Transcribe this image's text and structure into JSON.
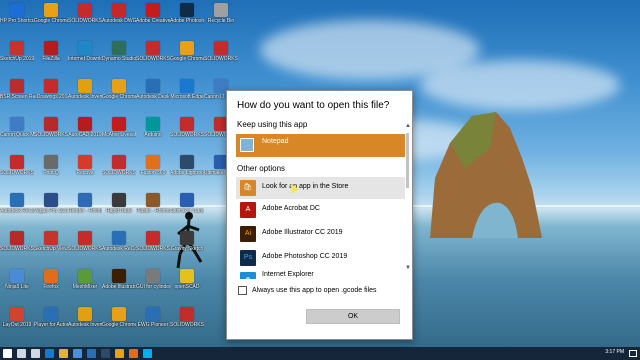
{
  "dialog": {
    "title": "How do you want to open this file?",
    "keep_using_label": "Keep using this app",
    "current_app": {
      "name": "Notepad",
      "icon": "notepad-icon",
      "color": "#7fb3d8"
    },
    "other_options_label": "Other options",
    "other_apps": [
      {
        "name": "Look for an app in the Store",
        "icon": "store-icon",
        "glyph": "🛍",
        "color": "#d88726"
      },
      {
        "name": "Adobe Acrobat DC",
        "icon": "acrobat-icon",
        "glyph": "A",
        "color": "#b3170f"
      },
      {
        "name": "Adobe Illustrator CC 2019",
        "icon": "illustrator-icon",
        "glyph": "Ai",
        "color": "#3b1f05"
      },
      {
        "name": "Adobe Photoshop CC 2019",
        "icon": "photoshop-icon",
        "glyph": "Ps",
        "color": "#0f2b48"
      },
      {
        "name": "Internet Explorer",
        "icon": "internet-explorer-icon",
        "glyph": "e",
        "color": "#1a8ed8"
      }
    ],
    "always_use_label": "Always use this app to open .gcode files",
    "always_use_checked": false,
    "ok_label": "OK"
  },
  "desktop_icons": [
    {
      "label": "HP Pro Shortcut",
      "color": "#1c6ed6"
    },
    {
      "label": "SketchUp 2019",
      "color": "#c4342c"
    },
    {
      "label": "BSR Screen Recorder 6",
      "color": "#b82e2e"
    },
    {
      "label": "Canon Quick Menu",
      "color": "#3e7cc4"
    },
    {
      "label": "SOLIDWORKS 2018",
      "color": "#c42c2c"
    },
    {
      "label": "Autodesk ReCap",
      "color": "#2a6fb6"
    },
    {
      "label": "SOLIDWORKS File Utilities",
      "color": "#b62a2a"
    },
    {
      "label": "Ninja5 Lite",
      "color": "#4b8ad6"
    },
    {
      "label": "LayOut 2019",
      "color": "#d2432d"
    },
    {
      "label": "Google Chrome",
      "color": "#e8a117"
    },
    {
      "label": "FileZilla",
      "color": "#b51d1d"
    },
    {
      "label": "eDrawings 2018",
      "color": "#c42c2c"
    },
    {
      "label": "SOLIDWORKS 2018",
      "color": "#b62a2a"
    },
    {
      "label": "Print Q",
      "color": "#6a6a6a"
    },
    {
      "label": "Vegas Pro 16.0",
      "color": "#2b4d8a"
    },
    {
      "label": "SketchUp Viewer 2019",
      "color": "#c4342c"
    },
    {
      "label": "Firefox",
      "color": "#e06d1b"
    },
    {
      "label": "Player for Autodesk",
      "color": "#2a6fb6"
    },
    {
      "label": "SOLIDWORKS 2018 x64",
      "color": "#c42c2c"
    },
    {
      "label": "Internet Download Manager",
      "color": "#1e88c8"
    },
    {
      "label": "Autodesk Inventor Pro",
      "color": "#e0a012"
    },
    {
      "label": "AutoCAD 2019",
      "color": "#b71c1c"
    },
    {
      "label": "Recuva",
      "color": "#d83a2a"
    },
    {
      "label": "Render - Rhinoceros",
      "color": "#2e6bb4"
    },
    {
      "label": "SOLIDWORKS Electrical",
      "color": "#c42c2c"
    },
    {
      "label": "MeshMixer",
      "color": "#5a9a3a"
    },
    {
      "label": "Autodesk Inventor",
      "color": "#e0a012"
    },
    {
      "label": "Autodesk DWG TrueView",
      "color": "#c62828"
    },
    {
      "label": "Dynamo Studio",
      "color": "#2f6f5a"
    },
    {
      "label": "Google Chrome",
      "color": "#e8a117"
    },
    {
      "label": "McAfee Livesafe",
      "color": "#c41c1c"
    },
    {
      "label": "SOLIDWORKS Composer",
      "color": "#c42c2c"
    },
    {
      "label": "RapidTrade",
      "color": "#3a3a3a"
    },
    {
      "label": "Autodesk ReCap Pro",
      "color": "#2a6fb6"
    },
    {
      "label": "Adobe Illustrator",
      "color": "#3b1f05"
    },
    {
      "label": "Google Chrome",
      "color": "#e8a117"
    },
    {
      "label": "Adobe Creative Cloud",
      "color": "#c41c1c"
    },
    {
      "label": "SOLIDWORKS Composer Player",
      "color": "#c42c2c"
    },
    {
      "label": "Autodesk Desktop App",
      "color": "#2a6fb6"
    },
    {
      "label": "Arduino",
      "color": "#00979c"
    },
    {
      "label": "Fusion 360",
      "color": "#e0701b"
    },
    {
      "label": "Plastic - Rhinoceros",
      "color": "#8a5a2a"
    },
    {
      "label": "SOLIDWORKS Plastics",
      "color": "#c42c2c"
    },
    {
      "label": "GUI for cylinders",
      "color": "#7a7a7a"
    },
    {
      "label": "EWG Pioneer",
      "color": "#2a6fb6"
    },
    {
      "label": "Adobe Photoshop CC",
      "color": "#0f2b48"
    },
    {
      "label": "Google Chrome",
      "color": "#e8a117"
    },
    {
      "label": "Microsoft Edge",
      "color": "#1a78d0"
    },
    {
      "label": "SOLIDWORKS Visualize",
      "color": "#c42c2c"
    },
    {
      "label": "Adobe Lightroom",
      "color": "#2d4a6b"
    },
    {
      "label": "Ultimaker Cura",
      "color": "#2a5fb0"
    },
    {
      "label": "Gravity Sketch",
      "color": "#3a3a3a"
    },
    {
      "label": "openSCAD",
      "color": "#e4c21b"
    },
    {
      "label": "SOLIDWORKS Inspection",
      "color": "#c42c2c"
    },
    {
      "label": "Recycle Bin",
      "color": "#a0a0a0"
    },
    {
      "label": "SOLIDWORKS Flow",
      "color": "#c42c2c"
    },
    {
      "label": "Canon IJ Scan Utility",
      "color": "#3e7cc4"
    },
    {
      "label": "SOLIDWORKS PCB",
      "color": "#c42c2c"
    },
    {
      "label": "Ultimaker Cura 4.0",
      "color": "#2a5fb0"
    }
  ],
  "taskbar": {
    "time": "3:17 PM",
    "icons": [
      {
        "name": "start",
        "color": "#ffffff"
      },
      {
        "name": "search",
        "color": "#cfd8e3"
      },
      {
        "name": "task-view",
        "color": "#cfd8e3"
      },
      {
        "name": "edge",
        "color": "#1a78d0"
      },
      {
        "name": "explorer",
        "color": "#e0b43a"
      },
      {
        "name": "store",
        "color": "#4a90d9"
      },
      {
        "name": "mail",
        "color": "#2a6fb6"
      },
      {
        "name": "photoshop",
        "color": "#2d4a6b"
      },
      {
        "name": "chrome",
        "color": "#e8a117"
      },
      {
        "name": "firefox",
        "color": "#e06d1b"
      },
      {
        "name": "skype",
        "color": "#00aff0"
      }
    ]
  }
}
